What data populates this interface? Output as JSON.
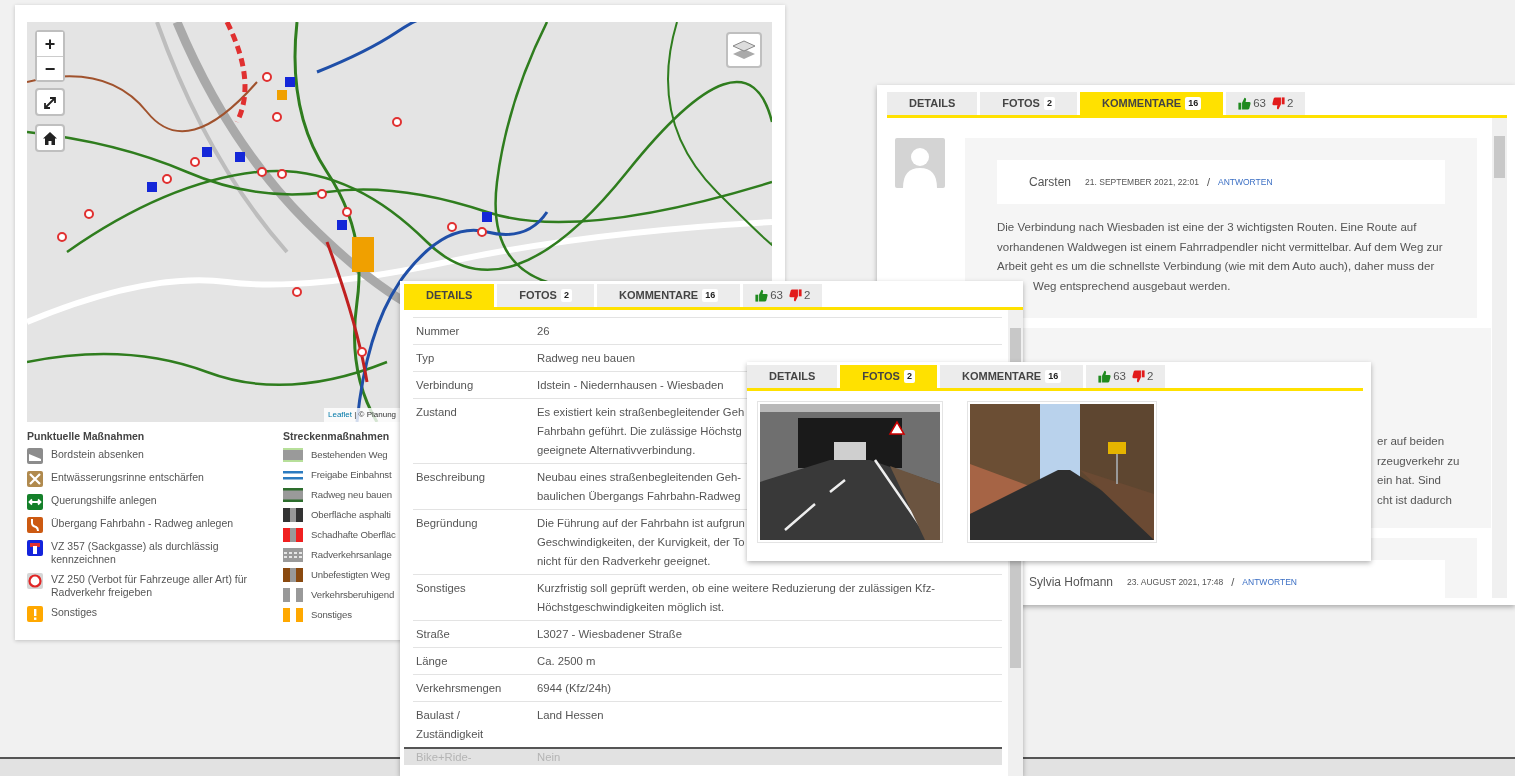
{
  "map_panel": {
    "zoom_in": "+",
    "zoom_out": "−",
    "attribution_link": "Leaflet",
    "attribution": "| © Planung",
    "legend": {
      "point_title": "Punktuelle Maßnahmen",
      "line_title": "Streckenmaßnahmen",
      "point_items": [
        {
          "kind": "curb",
          "label": "Bordstein absenken"
        },
        {
          "kind": "gutter",
          "label": "Entwässerungsrinne entschärfen"
        },
        {
          "kind": "crossing",
          "label": "Querungshilfe anlegen"
        },
        {
          "kind": "transition",
          "label": "Übergang Fahrbahn - Radweg anlegen"
        },
        {
          "kind": "deadend",
          "label": "VZ 357 (Sackgasse) als durchlässig kennzeichnen"
        },
        {
          "kind": "novehicles",
          "label": "VZ 250 (Verbot für Fahrzeuge aller Art) für Radverkehr freigeben"
        },
        {
          "kind": "other",
          "label": "Sonstiges"
        }
      ],
      "line_items": [
        {
          "kind": "existing",
          "label": "Bestehenden Weg"
        },
        {
          "kind": "oneway",
          "label": "Freigabe Einbahnst"
        },
        {
          "kind": "new",
          "label": "Radweg neu bauen"
        },
        {
          "kind": "asphalt",
          "label": "Oberfläche asphalti"
        },
        {
          "kind": "damaged",
          "label": "Schadhafte Oberfläc"
        },
        {
          "kind": "facility",
          "label": "Radverkehrsanlage"
        },
        {
          "kind": "unpaved",
          "label": "Unbefestigten Weg"
        },
        {
          "kind": "calming",
          "label": "Verkehrsberuhigend"
        },
        {
          "kind": "other",
          "label": "Sonstiges"
        }
      ]
    }
  },
  "comments_window": {
    "tabs": [
      {
        "label": "DETAILS",
        "selected": false
      },
      {
        "label": "FOTOS",
        "count": "2",
        "selected": false
      },
      {
        "label": "KOMMENTARE",
        "count": "16",
        "selected": true
      }
    ],
    "votes": {
      "up": "63",
      "down": "2"
    },
    "comments": [
      {
        "kind": "full",
        "author": "Carsten",
        "date": "21. SEPTEMBER 2021, 22:01",
        "separator": "/",
        "reply": "ANTWORTEN",
        "lines": [
          "Die Verbindung nach Wiesbaden ist eine der 3 wichtigsten Routen. Eine Route auf",
          "vorhandenen Waldwegen ist einem Fahrradpendler nicht vermittelbar. Auf dem Weg zur",
          "Arbeit geht es um die schnellste Verbindung (wie mit dem Auto auch), daher muss der"
        ],
        "tail": "Weg entsprechend ausgebaut werden."
      },
      {
        "kind": "covered",
        "lines": [
          "er auf beiden",
          "rzeugverkehr zu",
          "ein hat. Sind",
          "cht ist dadurch"
        ]
      },
      {
        "kind": "header",
        "author": "Sylvia Hofmann",
        "date": "23. AUGUST 2021, 17:48",
        "separator": "/",
        "reply": "ANTWORTEN"
      }
    ]
  },
  "details_window": {
    "tabs": [
      {
        "label": "DETAILS",
        "selected": true
      },
      {
        "label": "FOTOS",
        "count": "2",
        "selected": false
      },
      {
        "label": "KOMMENTARE",
        "count": "16",
        "selected": false
      }
    ],
    "votes": {
      "up": "63",
      "down": "2"
    },
    "rows": [
      {
        "label": "Nummer",
        "lines": [
          "26"
        ]
      },
      {
        "label": "Typ",
        "lines": [
          "Radweg neu bauen"
        ]
      },
      {
        "label": "Verbindung",
        "lines": [
          "Idstein - Niedernhausen - Wiesbaden"
        ]
      },
      {
        "label": "Zustand",
        "lines": [
          "Es existiert kein straßenbegleitender Geh",
          "Fahrbahn geführt. Die zulässige Höchstg",
          "geeignete Alternativverbindung."
        ]
      },
      {
        "label": "Beschreibung",
        "lines": [
          "Neubau eines straßenbegleitenden Geh-",
          "baulichen Übergangs Fahrbahn-Radweg"
        ]
      },
      {
        "label": "Begründung",
        "lines": [
          "Die Führung auf der Fahrbahn ist aufgrun",
          "Geschwindigkeiten, der Kurvigkeit, der To",
          "nicht für den Radverkehr geeignet."
        ]
      },
      {
        "label": "Sonstiges",
        "lines": [
          "Kurzfristig soll geprüft werden, ob eine weitere Reduzierung der zulässigen Kfz-",
          "Höchstgeschwindigkeiten möglich ist."
        ]
      },
      {
        "label": "Straße",
        "lines": [
          "L3027 - Wiesbadener Straße"
        ]
      },
      {
        "label": "Länge",
        "lines": [
          "Ca. 2500 m"
        ]
      },
      {
        "label": "Verkehrsmengen",
        "lines": [
          "6944 (Kfz/24h)"
        ]
      },
      {
        "label": "Baulast / Zuständigkeit",
        "lines": [
          "Land Hessen"
        ]
      },
      {
        "label": "Bike+Ride-",
        "lines": [
          "Nein"
        ],
        "faded": true
      }
    ]
  },
  "photos_window": {
    "tabs": [
      {
        "label": "DETAILS",
        "selected": false
      },
      {
        "label": "FOTOS",
        "count": "2",
        "selected": true
      },
      {
        "label": "KOMMENTARE",
        "count": "16",
        "selected": false
      }
    ],
    "votes": {
      "up": "63",
      "down": "2"
    },
    "photos": [
      {
        "kind": "underpass"
      },
      {
        "kind": "forest-road"
      }
    ]
  }
}
